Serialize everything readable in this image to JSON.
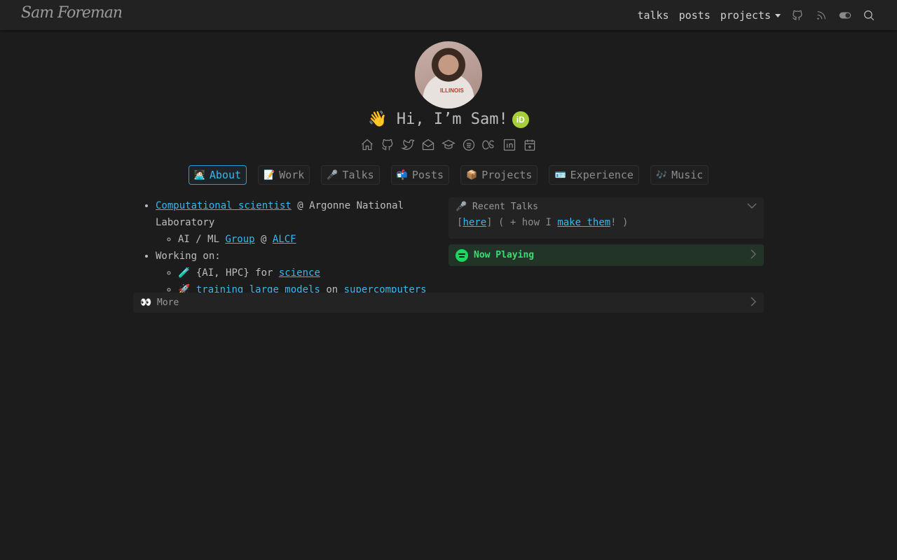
{
  "navbar": {
    "logo": "Sam Foreman",
    "links": [
      "talks",
      "posts",
      "projects"
    ]
  },
  "hero": {
    "shirt_text": "ILLINOIS",
    "greeting": "👋 Hi, I’m Sam!",
    "orcid": "iD"
  },
  "tabs": [
    {
      "emoji": "🧑🏻‍💻",
      "label": "About",
      "active": true
    },
    {
      "emoji": "📝",
      "label": "Work"
    },
    {
      "emoji": "🎤",
      "label": "Talks"
    },
    {
      "emoji": "📬",
      "label": "Posts"
    },
    {
      "emoji": "📦",
      "label": "Projects"
    },
    {
      "emoji": "🪪",
      "label": "Experience"
    },
    {
      "emoji": "🎶",
      "label": "Music"
    }
  ],
  "about": {
    "role_link": "Computational scientist",
    "role_at": " @ Argonne National Laboratory",
    "group_prefix": "AI / ML ",
    "group_link": "Group",
    "group_at": " @ ",
    "alcf_link": "ALCF",
    "working_on": "Working on:",
    "item1_emoji": "🧪",
    "item1_text": " {AI, HPC} for ",
    "item1_link": "science",
    "item2_emoji": "🚀",
    "item2_link": "training large models",
    "item2_on": " on ",
    "item2_link2": "supercomputers"
  },
  "recent_talks": {
    "title": "🎤 Recent Talks",
    "open_bracket": "[",
    "here_link": "here",
    "middle": "] ( + how I ",
    "make_link": "make them",
    "end": "! )"
  },
  "now_playing": {
    "title": "Now Playing"
  },
  "more": {
    "title": "👀 More"
  },
  "colors": {
    "accent": "#35b8ee",
    "background": "#1c1c1c",
    "spotify_green": "#1ed760",
    "orcid_green": "#a6ce39"
  }
}
